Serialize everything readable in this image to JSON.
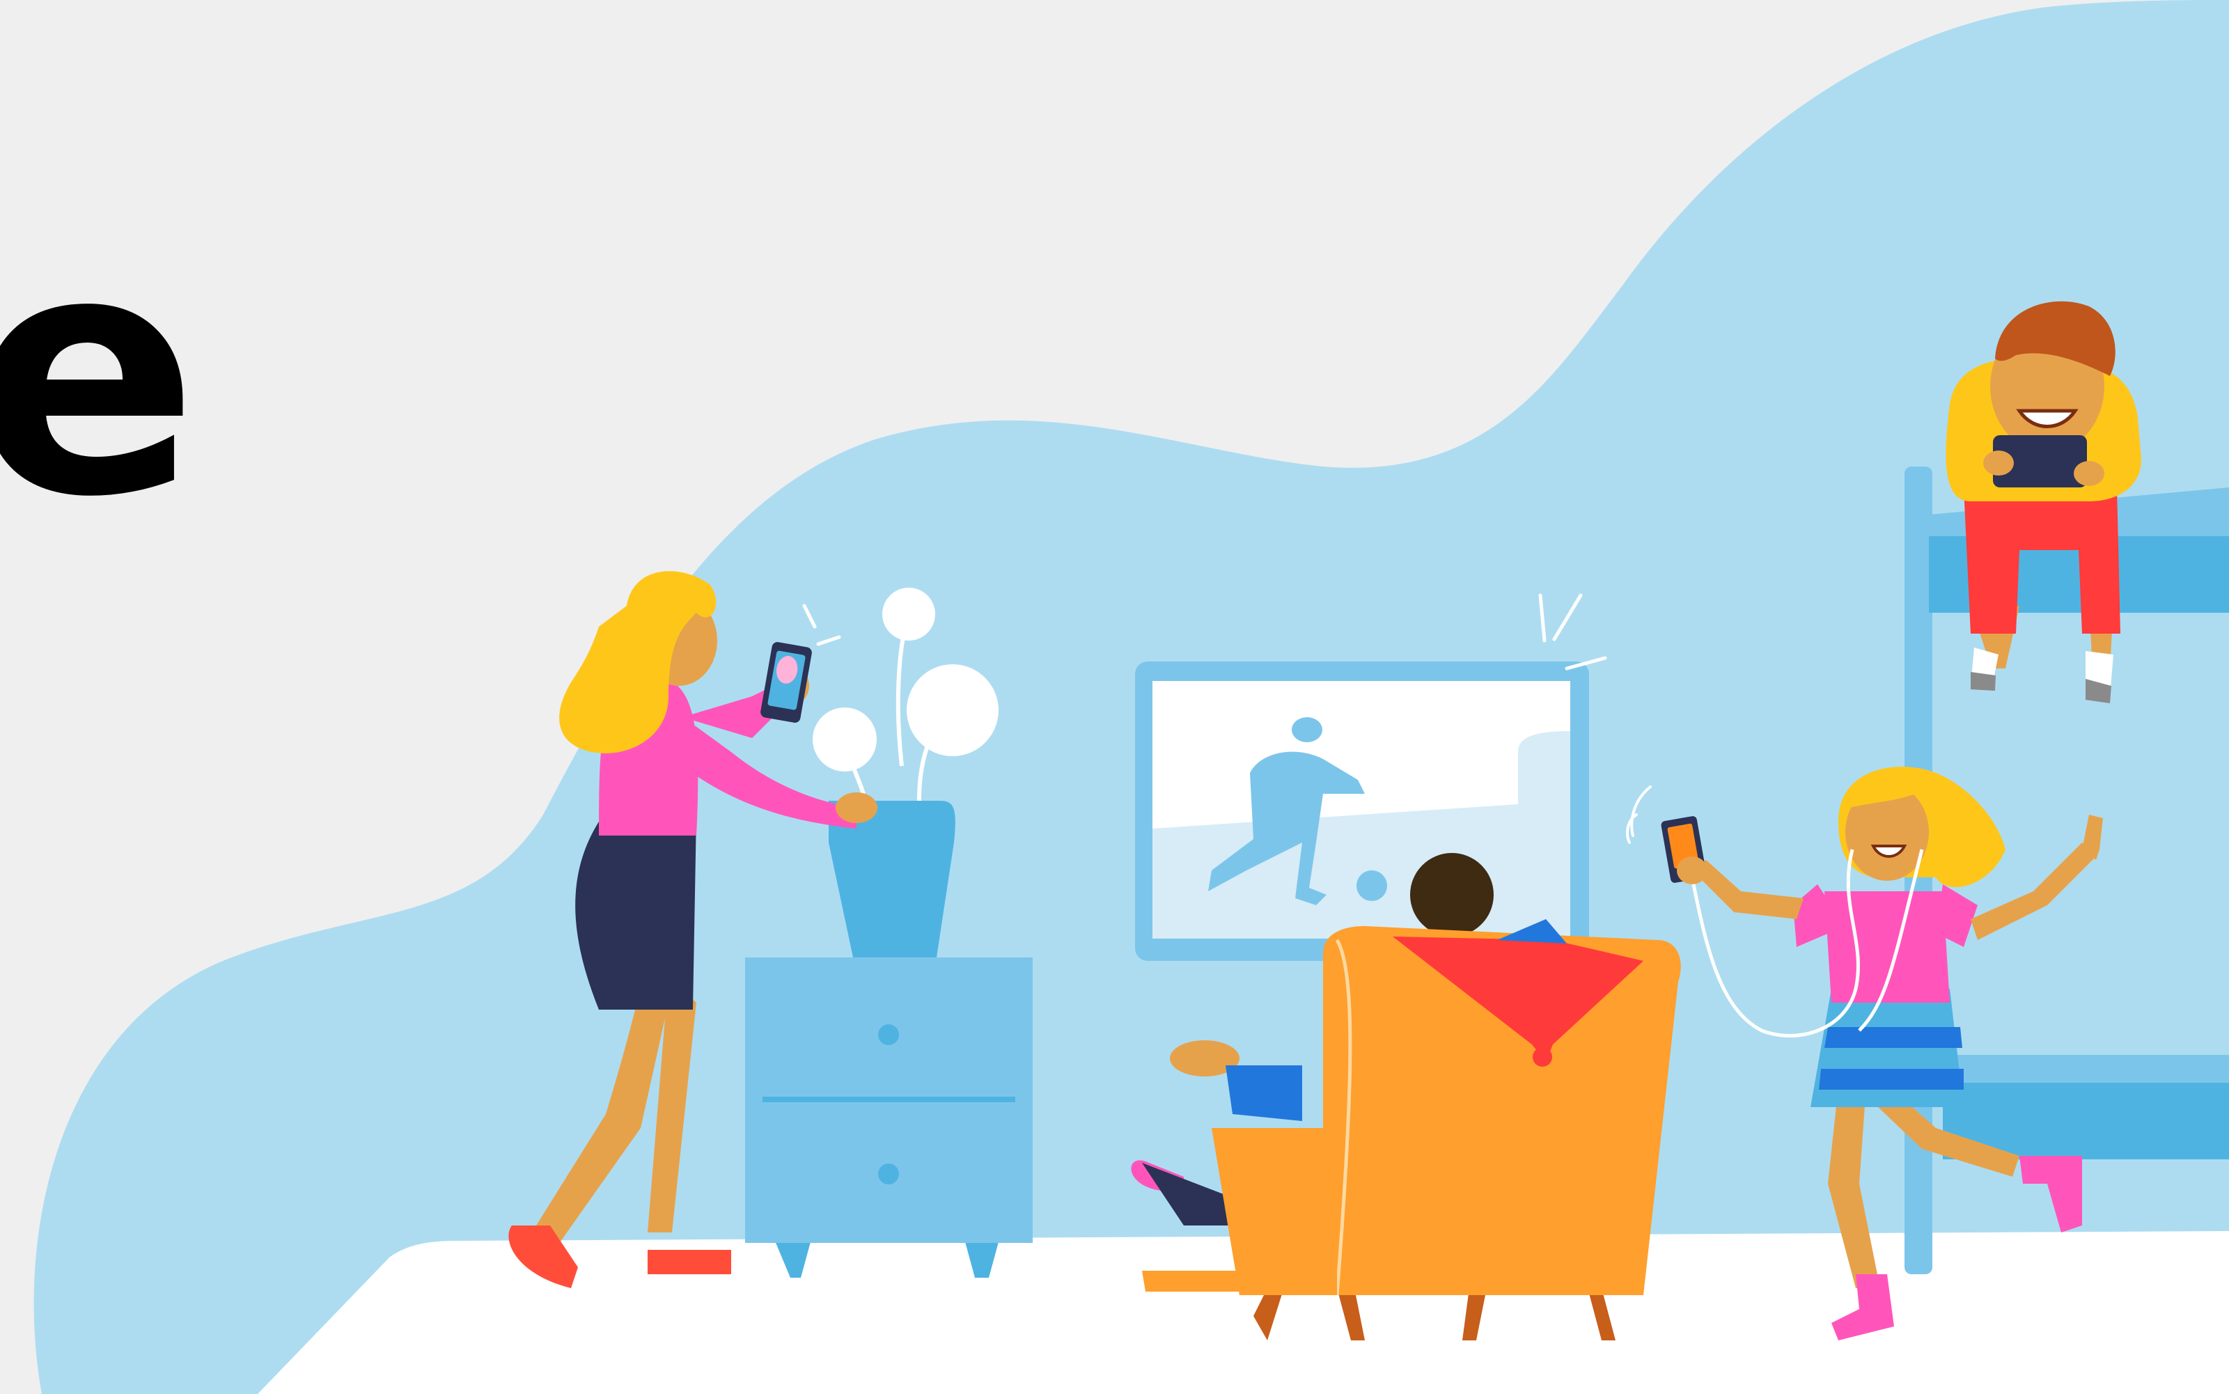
{
  "hero": {
    "headline_fragment": "e"
  },
  "colors": {
    "background": "#efefef",
    "blob": "#addcf1",
    "floor": "#ffffff",
    "furniture_light": "#7cc5ea",
    "furniture_mid": "#4fb3e2",
    "armchair": "#ff9f2d",
    "armchair_shadow": "#c75e1a",
    "hoodie": "#ff3a3a",
    "pink": "#ff55bb",
    "navy": "#2b3255",
    "yellow_hair": "#ffc61a",
    "skin": "#e6a24b",
    "orange_hair": "#c0561c",
    "pants_red": "#ff3b3b"
  },
  "illustration": {
    "icon_names": [
      "woman-with-phone-icon",
      "flower-vase-icon",
      "nightstand-icon",
      "television-icon",
      "soccer-player-on-screen-icon",
      "boy-in-armchair-icon",
      "dancing-girl-with-earphones-icon",
      "boy-on-bunk-bed-with-tablet-icon",
      "bunk-bed-icon"
    ]
  }
}
